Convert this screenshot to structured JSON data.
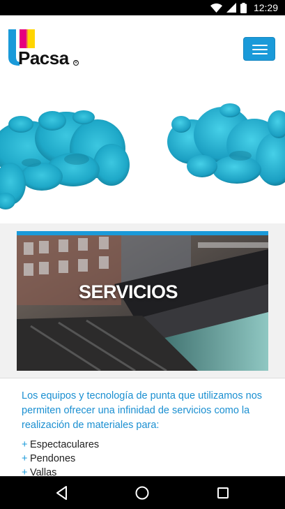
{
  "status_bar": {
    "time": "12:29",
    "icons": [
      "wifi-icon",
      "signal-icon",
      "battery-icon"
    ]
  },
  "header": {
    "logo_text": "Pacsa",
    "logo_colors": [
      "#1a9ad9",
      "#e6007e",
      "#ffd500"
    ],
    "menu_icon": "hamburger-icon",
    "menu_color": "#1a9ad9"
  },
  "hero": {
    "image": "cyan ink clouds"
  },
  "services": {
    "title": "SERVICIOS",
    "accent_color": "#1a9ad9"
  },
  "content": {
    "intro": "Los equipos y tecnología de punta que utilizamos nos permiten ofrecer una infinidad de servicios como la realización de materiales para:",
    "bullet_symbol": "+",
    "items": [
      "Espectaculares",
      "Pendones",
      "Vallas"
    ]
  },
  "nav_bar": {
    "buttons": [
      "back-icon",
      "home-icon",
      "recents-icon"
    ]
  }
}
